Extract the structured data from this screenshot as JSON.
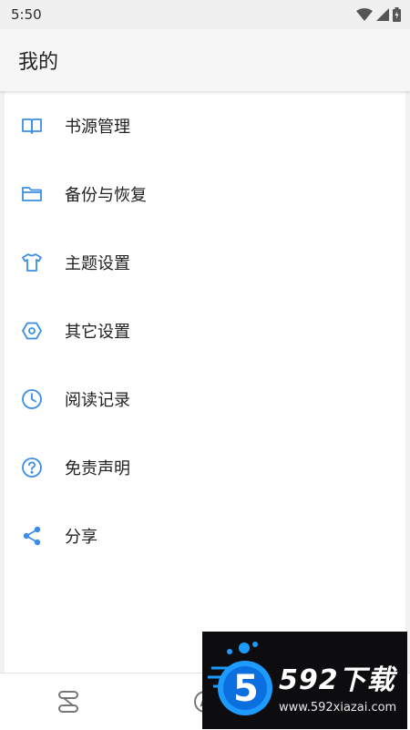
{
  "status_bar": {
    "time": "5:50"
  },
  "app_bar": {
    "title": "我的"
  },
  "menu": {
    "items": [
      {
        "label": "书源管理",
        "icon": "book-icon"
      },
      {
        "label": "备份与恢复",
        "icon": "folder-icon"
      },
      {
        "label": "主题设置",
        "icon": "tshirt-icon"
      },
      {
        "label": "其它设置",
        "icon": "hexagon-settings-icon"
      },
      {
        "label": "阅读记录",
        "icon": "clock-icon"
      },
      {
        "label": "免责声明",
        "icon": "help-icon"
      },
      {
        "label": "分享",
        "icon": "share-icon"
      }
    ]
  },
  "bottom_nav": {
    "items": [
      {
        "icon": "bookshelf-icon"
      },
      {
        "icon": "explore-icon"
      }
    ]
  },
  "watermark": {
    "brand": "592下载",
    "url": "www.592xiazai.com",
    "logo_digit": "5"
  },
  "colors": {
    "accent": "#3a8ee6",
    "background": "#f2f2f2",
    "surface": "#ffffff"
  }
}
